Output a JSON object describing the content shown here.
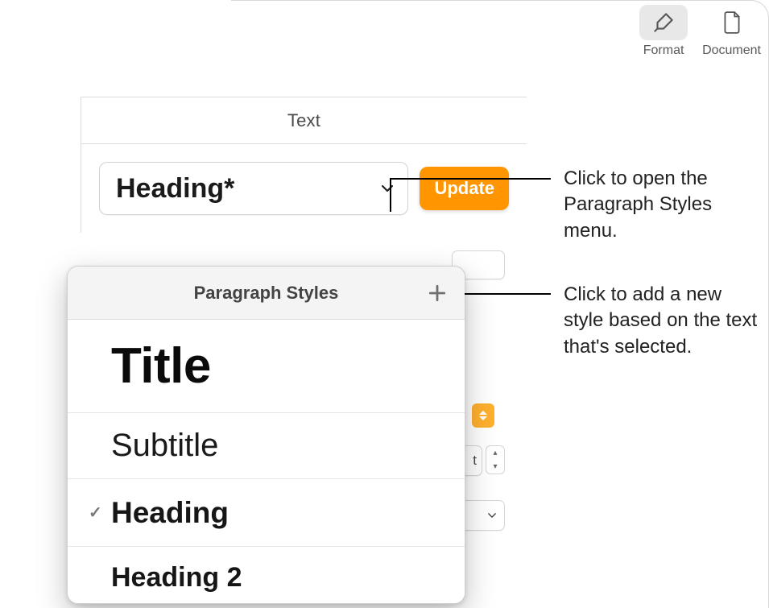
{
  "toolbar": {
    "format_label": "Format",
    "document_label": "Document"
  },
  "inspector": {
    "section_title": "Text",
    "current_style": "Heading*",
    "update_label": "Update",
    "hidden_size_suffix": "t"
  },
  "popover": {
    "title": "Paragraph Styles",
    "items": [
      {
        "label": "Title",
        "checked": false
      },
      {
        "label": "Subtitle",
        "checked": false
      },
      {
        "label": "Heading",
        "checked": true
      },
      {
        "label": "Heading 2",
        "checked": false
      }
    ]
  },
  "callouts": {
    "open_menu": "Click to open the Paragraph Styles menu.",
    "add_style": "Click to add a new style based on the text that's selected."
  }
}
